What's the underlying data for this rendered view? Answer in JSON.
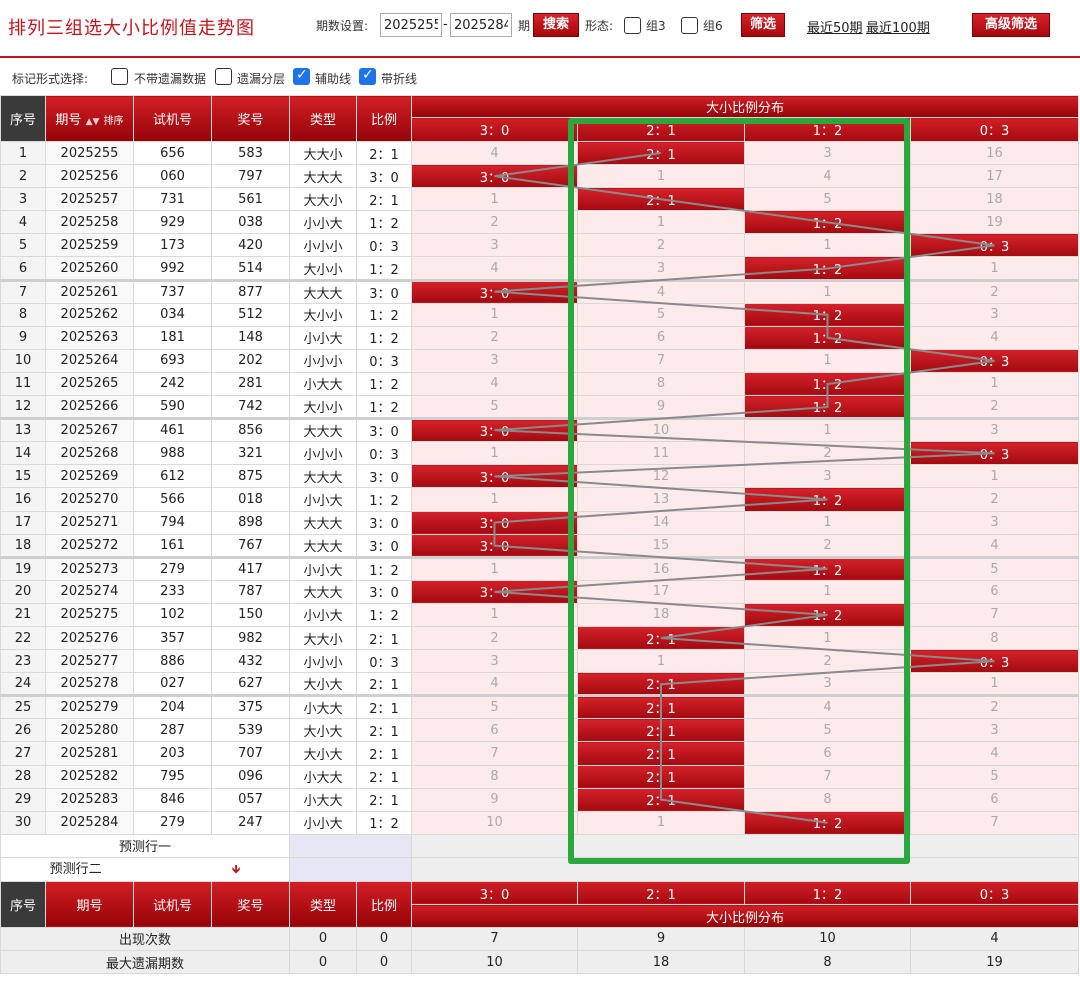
{
  "page": {
    "title": "排列三组选大小比例值走势图",
    "period_label": "期数设置:",
    "period_from": "2025255",
    "period_to": "2025284",
    "period_unit": "期",
    "search_label": "搜索",
    "shape_label": "形态:",
    "group3_label": "组3",
    "group6_label": "组6",
    "filter_label": "筛选",
    "recent50": "最近50期",
    "recent100": "最近100期",
    "advanced_label": "高级筛选"
  },
  "mark_bar": {
    "label": "标记形式选择:",
    "opt_no_missing": "不带遗漏数据",
    "opt_missing_layer": "遗漏分层",
    "opt_aux_line": "辅助线",
    "opt_polyline": "带折线",
    "checked": [
      false,
      false,
      true,
      true
    ]
  },
  "header": {
    "seq": "序号",
    "period": "期号",
    "sort": "排序",
    "trial": "试机号",
    "prize": "奖号",
    "type": "类型",
    "ratio": "比例",
    "dist_title": "大小比例分布",
    "dist_cols": [
      "3：0",
      "2：1",
      "1：2",
      "0：3"
    ]
  },
  "rows": [
    {
      "seq": "1",
      "period": "2025255",
      "trial": "656",
      "prize": "583",
      "type": "大大小",
      "ratio": "2：1",
      "dist": [
        "4",
        "2：1",
        "3",
        "16"
      ],
      "hit": 1
    },
    {
      "seq": "2",
      "period": "2025256",
      "trial": "060",
      "prize": "797",
      "type": "大大大",
      "ratio": "3：0",
      "dist": [
        "3：0",
        "1",
        "4",
        "17"
      ],
      "hit": 0
    },
    {
      "seq": "3",
      "period": "2025257",
      "trial": "731",
      "prize": "561",
      "type": "大大小",
      "ratio": "2：1",
      "dist": [
        "1",
        "2：1",
        "5",
        "18"
      ],
      "hit": 1
    },
    {
      "seq": "4",
      "period": "2025258",
      "trial": "929",
      "prize": "038",
      "type": "小小大",
      "ratio": "1：2",
      "dist": [
        "2",
        "1",
        "1：2",
        "19"
      ],
      "hit": 2
    },
    {
      "seq": "5",
      "period": "2025259",
      "trial": "173",
      "prize": "420",
      "type": "小小小",
      "ratio": "0：3",
      "dist": [
        "3",
        "2",
        "1",
        "0：3"
      ],
      "hit": 3
    },
    {
      "seq": "6",
      "period": "2025260",
      "trial": "992",
      "prize": "514",
      "type": "大小小",
      "ratio": "1：2",
      "dist": [
        "4",
        "3",
        "1：2",
        "1"
      ],
      "hit": 2
    },
    {
      "seq": "7",
      "period": "2025261",
      "trial": "737",
      "prize": "877",
      "type": "大大大",
      "ratio": "3：0",
      "dist": [
        "3：0",
        "4",
        "1",
        "2"
      ],
      "hit": 0
    },
    {
      "seq": "8",
      "period": "2025262",
      "trial": "034",
      "prize": "512",
      "type": "大小小",
      "ratio": "1：2",
      "dist": [
        "1",
        "5",
        "1：2",
        "3"
      ],
      "hit": 2
    },
    {
      "seq": "9",
      "period": "2025263",
      "trial": "181",
      "prize": "148",
      "type": "小小大",
      "ratio": "1：2",
      "dist": [
        "2",
        "6",
        "1：2",
        "4"
      ],
      "hit": 2
    },
    {
      "seq": "10",
      "period": "2025264",
      "trial": "693",
      "prize": "202",
      "type": "小小小",
      "ratio": "0：3",
      "dist": [
        "3",
        "7",
        "1",
        "0：3"
      ],
      "hit": 3
    },
    {
      "seq": "11",
      "period": "2025265",
      "trial": "242",
      "prize": "281",
      "type": "小大大",
      "ratio": "1：2",
      "dist": [
        "4",
        "8",
        "1：2",
        "1"
      ],
      "hit": 2
    },
    {
      "seq": "12",
      "period": "2025266",
      "trial": "590",
      "prize": "742",
      "type": "大小小",
      "ratio": "1：2",
      "dist": [
        "5",
        "9",
        "1：2",
        "2"
      ],
      "hit": 2
    },
    {
      "seq": "13",
      "period": "2025267",
      "trial": "461",
      "prize": "856",
      "type": "大大大",
      "ratio": "3：0",
      "dist": [
        "3：0",
        "10",
        "1",
        "3"
      ],
      "hit": 0
    },
    {
      "seq": "14",
      "period": "2025268",
      "trial": "988",
      "prize": "321",
      "type": "小小小",
      "ratio": "0：3",
      "dist": [
        "1",
        "11",
        "2",
        "0：3"
      ],
      "hit": 3
    },
    {
      "seq": "15",
      "period": "2025269",
      "trial": "612",
      "prize": "875",
      "type": "大大大",
      "ratio": "3：0",
      "dist": [
        "3：0",
        "12",
        "3",
        "1"
      ],
      "hit": 0
    },
    {
      "seq": "16",
      "period": "2025270",
      "trial": "566",
      "prize": "018",
      "type": "小小大",
      "ratio": "1：2",
      "dist": [
        "1",
        "13",
        "1：2",
        "2"
      ],
      "hit": 2
    },
    {
      "seq": "17",
      "period": "2025271",
      "trial": "794",
      "prize": "898",
      "type": "大大大",
      "ratio": "3：0",
      "dist": [
        "3：0",
        "14",
        "1",
        "3"
      ],
      "hit": 0
    },
    {
      "seq": "18",
      "period": "2025272",
      "trial": "161",
      "prize": "767",
      "type": "大大大",
      "ratio": "3：0",
      "dist": [
        "3：0",
        "15",
        "2",
        "4"
      ],
      "hit": 0
    },
    {
      "seq": "19",
      "period": "2025273",
      "trial": "279",
      "prize": "417",
      "type": "小小大",
      "ratio": "1：2",
      "dist": [
        "1",
        "16",
        "1：2",
        "5"
      ],
      "hit": 2
    },
    {
      "seq": "20",
      "period": "2025274",
      "trial": "233",
      "prize": "787",
      "type": "大大大",
      "ratio": "3：0",
      "dist": [
        "3：0",
        "17",
        "1",
        "6"
      ],
      "hit": 0
    },
    {
      "seq": "21",
      "period": "2025275",
      "trial": "102",
      "prize": "150",
      "type": "小小大",
      "ratio": "1：2",
      "dist": [
        "1",
        "18",
        "1：2",
        "7"
      ],
      "hit": 2
    },
    {
      "seq": "22",
      "period": "2025276",
      "trial": "357",
      "prize": "982",
      "type": "大大小",
      "ratio": "2：1",
      "dist": [
        "2",
        "2：1",
        "1",
        "8"
      ],
      "hit": 1
    },
    {
      "seq": "23",
      "period": "2025277",
      "trial": "886",
      "prize": "432",
      "type": "小小小",
      "ratio": "0：3",
      "dist": [
        "3",
        "1",
        "2",
        "0：3"
      ],
      "hit": 3
    },
    {
      "seq": "24",
      "period": "2025278",
      "trial": "027",
      "prize": "627",
      "type": "大小大",
      "ratio": "2：1",
      "dist": [
        "4",
        "2：1",
        "3",
        "1"
      ],
      "hit": 1
    },
    {
      "seq": "25",
      "period": "2025279",
      "trial": "204",
      "prize": "375",
      "type": "小大大",
      "ratio": "2：1",
      "dist": [
        "5",
        "2：1",
        "4",
        "2"
      ],
      "hit": 1
    },
    {
      "seq": "26",
      "period": "2025280",
      "trial": "287",
      "prize": "539",
      "type": "大小大",
      "ratio": "2：1",
      "dist": [
        "6",
        "2：1",
        "5",
        "3"
      ],
      "hit": 1
    },
    {
      "seq": "27",
      "period": "2025281",
      "trial": "203",
      "prize": "707",
      "type": "大小大",
      "ratio": "2：1",
      "dist": [
        "7",
        "2：1",
        "6",
        "4"
      ],
      "hit": 1
    },
    {
      "seq": "28",
      "period": "2025282",
      "trial": "795",
      "prize": "096",
      "type": "小大大",
      "ratio": "2：1",
      "dist": [
        "8",
        "2：1",
        "7",
        "5"
      ],
      "hit": 1
    },
    {
      "seq": "29",
      "period": "2025283",
      "trial": "846",
      "prize": "057",
      "type": "小大大",
      "ratio": "2：1",
      "dist": [
        "9",
        "2：1",
        "8",
        "6"
      ],
      "hit": 1
    },
    {
      "seq": "30",
      "period": "2025284",
      "trial": "279",
      "prize": "247",
      "type": "小小大",
      "ratio": "1：2",
      "dist": [
        "10",
        "1",
        "1：2",
        "7"
      ],
      "hit": 2
    }
  ],
  "predict": {
    "row1": "预测行一",
    "row2": "预测行二"
  },
  "stats": {
    "occurrence_label": "出现次数",
    "occurrence": [
      "0",
      "0",
      "7",
      "9",
      "10",
      "4"
    ],
    "max_missing_label": "最大遗漏期数",
    "max_missing": [
      "0",
      "0",
      "10",
      "18",
      "8",
      "19"
    ]
  },
  "colors": {
    "brand_red": "#c5141c",
    "highlight_green": "#2aa83d",
    "hit_cell_red": "#d6212a",
    "miss_cell_pink": "#fdeaea"
  }
}
